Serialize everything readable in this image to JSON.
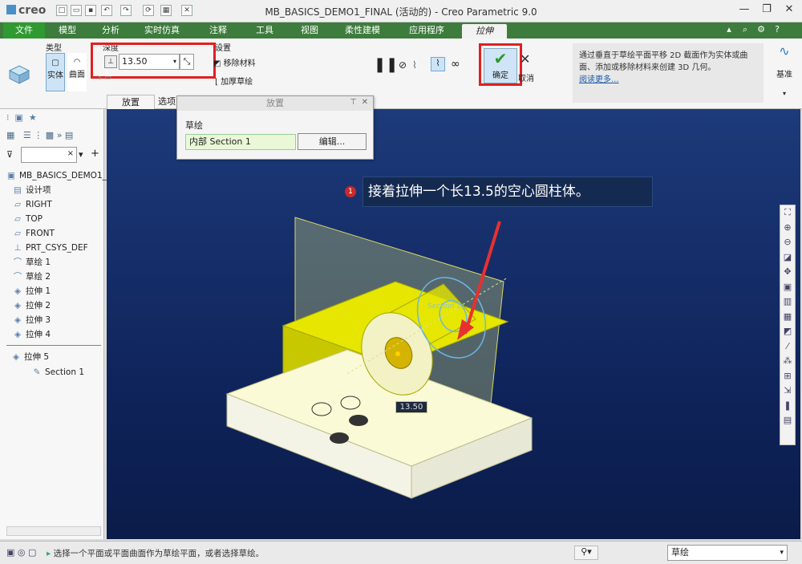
{
  "titlebar": {
    "logo": "creo",
    "title": "MB_BASICS_DEMO1_FINAL (活动的) - Creo Parametric 9.0",
    "controls": [
      "—",
      "❐",
      "✕"
    ]
  },
  "menu": {
    "file": "文件",
    "items": [
      "模型",
      "分析",
      "实时仿真",
      "注释",
      "工具",
      "视图",
      "柔性建模",
      "应用程序"
    ],
    "active": "拉伸"
  },
  "ribbon": {
    "type_label": "类型",
    "solid": "实体",
    "surface": "曲面",
    "depth_label": "深度",
    "depth_value": "13.50",
    "settings_label": "设置",
    "remove_material": "移除材料",
    "thicken_sketch": "加厚草绘",
    "ok": "确定",
    "cancel": "取消",
    "hint": "通过垂直于草绘平面平移 2D 截面作为实体或曲面、添加或移除材料来创建 3D 几何。",
    "hint_link": "阅读更多...",
    "datum": "基准"
  },
  "subtabs": {
    "placement": "放置",
    "options": "选项"
  },
  "placement_panel": {
    "title": "放置",
    "sketch_label": "草绘",
    "section": "内部 Section 1",
    "edit": "编辑..."
  },
  "tree": {
    "items": [
      "MB_BASICS_DEMO1_",
      "设计项",
      "RIGHT",
      "TOP",
      "FRONT",
      "PRT_CSYS_DEF",
      "草绘 1",
      "草绘 2",
      "拉伸 1",
      "拉伸 2",
      "拉伸 3",
      "拉伸 4",
      "拉伸 5",
      "Section 1"
    ]
  },
  "viewport": {
    "callout": "接着拉伸一个长13.5的空心圆柱体。",
    "badge": "1",
    "dim": "13.50",
    "section_label": "Section 1"
  },
  "status": {
    "message": "选择一个平面或平面曲面作为草绘平面，或者选择草绘。",
    "filter": "草绘"
  },
  "colors": {
    "accent_green": "#3d7c3d",
    "highlight_red": "#e02020",
    "viewport_blue": "#0e2258",
    "part_yellow": "#e6e600"
  }
}
